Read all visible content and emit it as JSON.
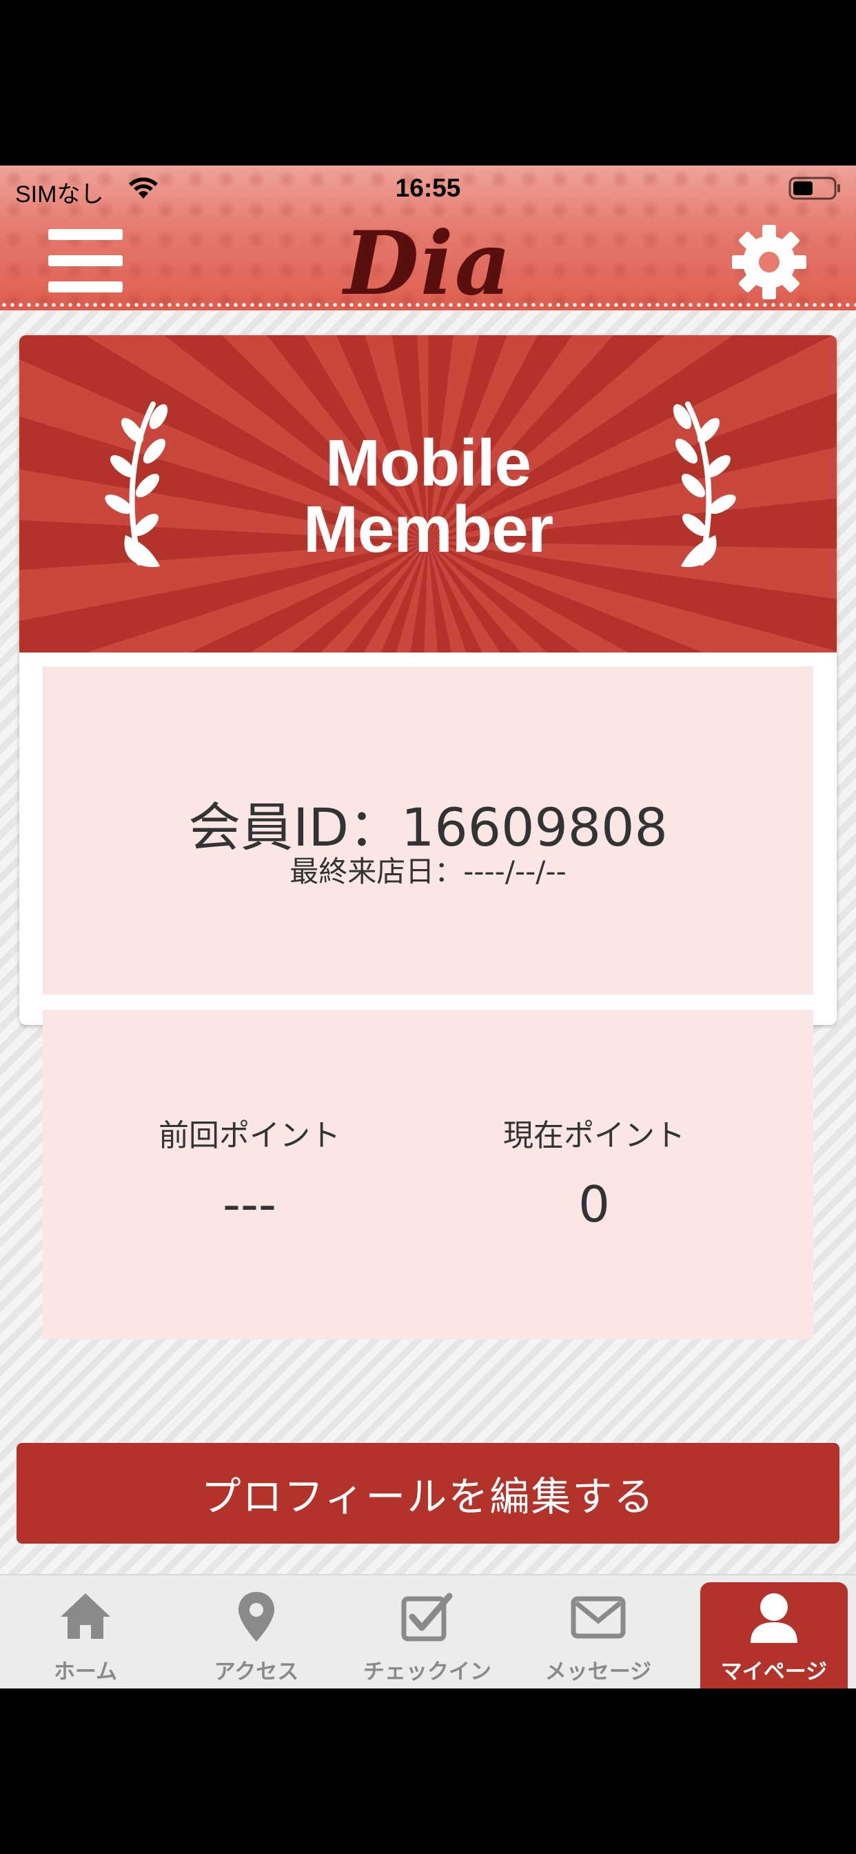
{
  "status_bar": {
    "carrier": "SIMなし",
    "time": "16:55"
  },
  "header": {
    "logo": "Dia",
    "menu_icon": "hamburger-menu-icon",
    "settings_icon": "gear-icon"
  },
  "banner": {
    "title_line1": "Mobile",
    "title_line2": "Member"
  },
  "member": {
    "id_label": "会員ID：16609808",
    "last_visit": "最終来店日：----/--/--"
  },
  "points": {
    "previous_label": "前回ポイント",
    "previous_value": "---",
    "current_label": "現在ポイント",
    "current_value": "0"
  },
  "actions": {
    "edit_profile": "プロフィールを編集する"
  },
  "tabs": [
    {
      "label": "ホーム",
      "icon": "home-icon",
      "active": false
    },
    {
      "label": "アクセス",
      "icon": "map-pin-icon",
      "active": false
    },
    {
      "label": "チェックイン",
      "icon": "checkbox-icon",
      "active": false
    },
    {
      "label": "メッセージ",
      "icon": "envelope-icon",
      "active": false
    },
    {
      "label": "マイページ",
      "icon": "user-icon",
      "active": true
    }
  ],
  "colors": {
    "accent": "#b3322a",
    "panel": "#fbe6e6",
    "tab_inactive": "#8a8a8a"
  }
}
